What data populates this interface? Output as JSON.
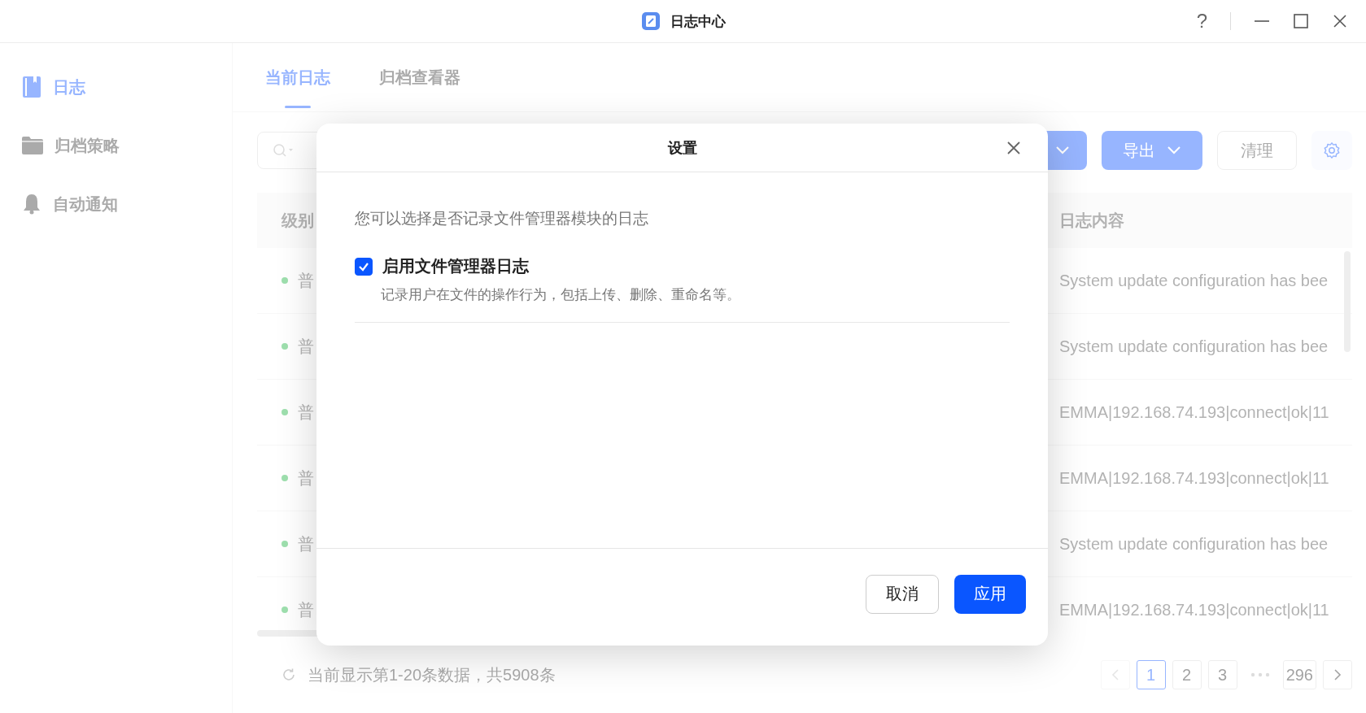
{
  "window": {
    "title": "日志中心",
    "help": "?"
  },
  "sidebar": {
    "items": [
      {
        "label": "日志",
        "kind": "book",
        "selected": true
      },
      {
        "label": "归档策略",
        "kind": "folder",
        "selected": false
      },
      {
        "label": "自动通知",
        "kind": "bell",
        "selected": false
      }
    ]
  },
  "tabs": [
    {
      "label": "当前日志",
      "selected": true
    },
    {
      "label": "归档查看器",
      "selected": false
    }
  ],
  "toolbar": {
    "buttons": [
      {
        "kind": "menu",
        "label": "导出"
      },
      {
        "kind": "plain",
        "label": "清理"
      }
    ]
  },
  "table": {
    "columns": [
      "级别",
      "日志内容"
    ],
    "rows": [
      {
        "level": "普",
        "content": "System update configuration has bee"
      },
      {
        "level": "普",
        "content": "System update configuration has bee"
      },
      {
        "level": "普",
        "content": "EMMA|192.168.74.193|connect|ok|11"
      },
      {
        "level": "普",
        "content": "EMMA|192.168.74.193|connect|ok|11"
      },
      {
        "level": "普",
        "content": "System update configuration has bee"
      },
      {
        "level": "普",
        "content": "EMMA|192.168.74.193|connect|ok|11"
      }
    ]
  },
  "footer": {
    "summary": "当前显示第1-20条数据，共5908条",
    "prev_disabled": true,
    "pages": [
      {
        "kind": "page",
        "label": "1",
        "selected": true
      },
      {
        "kind": "page",
        "label": "2",
        "selected": false
      },
      {
        "kind": "page",
        "label": "3",
        "selected": false
      },
      {
        "kind": "gap"
      },
      {
        "kind": "page",
        "label": "296",
        "selected": false
      }
    ]
  },
  "dialog": {
    "title": "设置",
    "description": "您可以选择是否记录文件管理器模块的日志",
    "option": {
      "label": "启用文件管理器日志",
      "checked": true,
      "hint": "记录用户在文件的操作行为，包括上传、删除、重命名等。"
    },
    "buttons": [
      {
        "kind": "secondary",
        "label": "取消"
      },
      {
        "kind": "primary",
        "label": "应用"
      }
    ]
  }
}
